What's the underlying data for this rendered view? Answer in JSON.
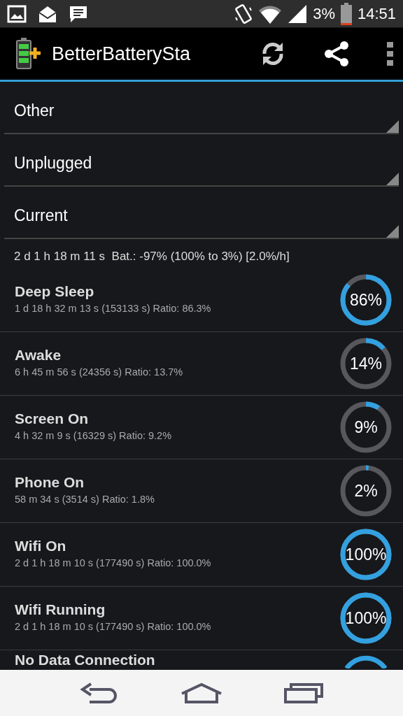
{
  "status_bar": {
    "battery_percent": "3%",
    "time": "14:51"
  },
  "action_bar": {
    "title": "BetterBatterySta"
  },
  "spinners": [
    {
      "label": "Other"
    },
    {
      "label": "Unplugged"
    },
    {
      "label": "Current"
    }
  ],
  "summary": "2 d 1 h 18 m 11 s  Bat.: -97% (100% to 3%) [2.0%/h]",
  "rows": [
    {
      "title": "Deep Sleep",
      "detail": "1 d 18 h 32 m 13 s  (153133 s) Ratio: 86.3%",
      "percent": "86%",
      "level": 0.863
    },
    {
      "title": "Awake",
      "detail": "6 h 45 m 56 s  (24356 s) Ratio: 13.7%",
      "percent": "14%",
      "level": 0.137
    },
    {
      "title": "Screen On",
      "detail": "4 h 32 m 9 s  (16329 s) Ratio: 9.2%",
      "percent": "9%",
      "level": 0.092
    },
    {
      "title": "Phone On",
      "detail": "58 m 34 s  (3514 s) Ratio: 1.8%",
      "percent": "2%",
      "level": 0.018
    },
    {
      "title": "Wifi On",
      "detail": "2 d 1 h 18 m 10 s  (177490 s) Ratio: 100.0%",
      "percent": "100%",
      "level": 1
    },
    {
      "title": "Wifi Running",
      "detail": "2 d 1 h 18 m 10 s  (177490 s) Ratio: 100.0%",
      "percent": "100%",
      "level": 1
    },
    {
      "title": "No Data Connection"
    }
  ]
}
